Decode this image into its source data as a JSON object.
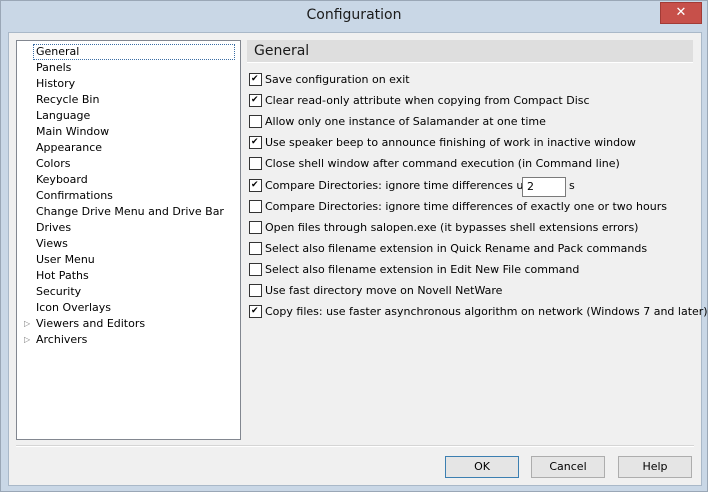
{
  "window": {
    "title": "Configuration",
    "close_icon": "close-icon"
  },
  "tree": {
    "items": [
      {
        "label": "General",
        "selected": true
      },
      {
        "label": "Panels"
      },
      {
        "label": "History"
      },
      {
        "label": "Recycle Bin"
      },
      {
        "label": "Language"
      },
      {
        "label": "Main Window"
      },
      {
        "label": "Appearance"
      },
      {
        "label": "Colors"
      },
      {
        "label": "Keyboard"
      },
      {
        "label": "Confirmations"
      },
      {
        "label": "Change Drive Menu and Drive Bar"
      },
      {
        "label": "Drives"
      },
      {
        "label": "Views"
      },
      {
        "label": "User Menu"
      },
      {
        "label": "Hot Paths"
      },
      {
        "label": "Security"
      },
      {
        "label": "Icon Overlays"
      },
      {
        "label": "Viewers and Editors",
        "expandable": true
      },
      {
        "label": "Archivers",
        "expandable": true
      }
    ]
  },
  "panel": {
    "title": "General",
    "options": [
      {
        "label": "Save configuration on exit",
        "checked": true
      },
      {
        "label": "Clear read-only attribute when copying from Compact Disc",
        "checked": true
      },
      {
        "label": "Allow only one instance of Salamander at one time",
        "checked": false
      },
      {
        "label": "Use speaker beep to announce finishing of work in inactive window",
        "checked": true
      },
      {
        "label": "Close shell window after command execution (in Command line)",
        "checked": false
      },
      {
        "label": "Compare Directories: ignore time differences up to",
        "checked": true
      },
      {
        "label": "Compare Directories: ignore time differences of exactly one or two hours",
        "checked": false
      },
      {
        "label": "Open files through salopen.exe (it bypasses shell extensions errors)",
        "checked": false
      },
      {
        "label": "Select also filename extension in Quick Rename and Pack commands",
        "checked": false
      },
      {
        "label": "Select also filename extension in Edit New File command",
        "checked": false
      },
      {
        "label": "Use fast directory move on Novell NetWare",
        "checked": false
      },
      {
        "label": "Copy files: use faster asynchronous algorithm on network (Windows 7 and later)",
        "checked": true
      }
    ],
    "time_diff": {
      "value": "2",
      "unit": "s"
    }
  },
  "buttons": {
    "ok": "OK",
    "cancel": "Cancel",
    "help": "Help"
  }
}
